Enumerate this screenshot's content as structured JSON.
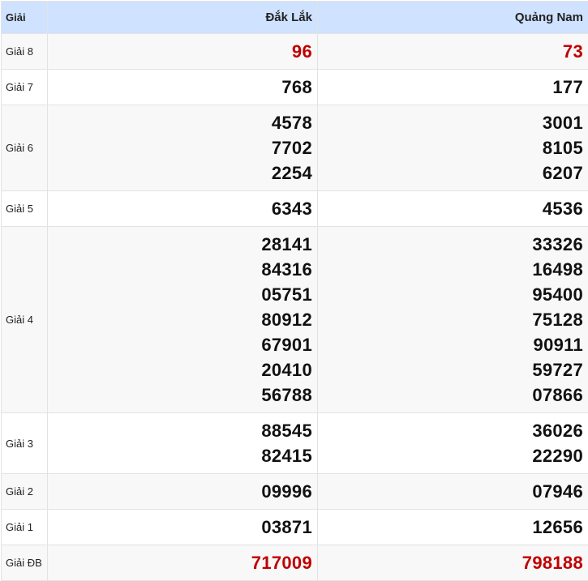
{
  "header": {
    "label": "Giải",
    "provinces": [
      "Đắk Lắk",
      "Quảng Nam"
    ]
  },
  "prizes": [
    {
      "label": "Giải 8",
      "red": true,
      "left": [
        "96"
      ],
      "right": [
        "73"
      ]
    },
    {
      "label": "Giải 7",
      "red": false,
      "left": [
        "768"
      ],
      "right": [
        "177"
      ]
    },
    {
      "label": "Giải 6",
      "red": false,
      "left": [
        "4578",
        "7702",
        "2254"
      ],
      "right": [
        "3001",
        "8105",
        "6207"
      ]
    },
    {
      "label": "Giải 5",
      "red": false,
      "left": [
        "6343"
      ],
      "right": [
        "4536"
      ]
    },
    {
      "label": "Giải 4",
      "red": false,
      "left": [
        "28141",
        "84316",
        "05751",
        "80912",
        "67901",
        "20410",
        "56788"
      ],
      "right": [
        "33326",
        "16498",
        "95400",
        "75128",
        "90911",
        "59727",
        "07866"
      ]
    },
    {
      "label": "Giải 3",
      "red": false,
      "left": [
        "88545",
        "82415"
      ],
      "right": [
        "36026",
        "22290"
      ]
    },
    {
      "label": "Giải 2",
      "red": false,
      "left": [
        "09996"
      ],
      "right": [
        "07946"
      ]
    },
    {
      "label": "Giải 1",
      "red": false,
      "left": [
        "03871"
      ],
      "right": [
        "12656"
      ]
    },
    {
      "label": "Giải ĐB",
      "red": true,
      "left": [
        "717009"
      ],
      "right": [
        "798188"
      ]
    }
  ],
  "colors": {
    "header_bg": "#cfe2ff",
    "highlight": "#c00000"
  }
}
